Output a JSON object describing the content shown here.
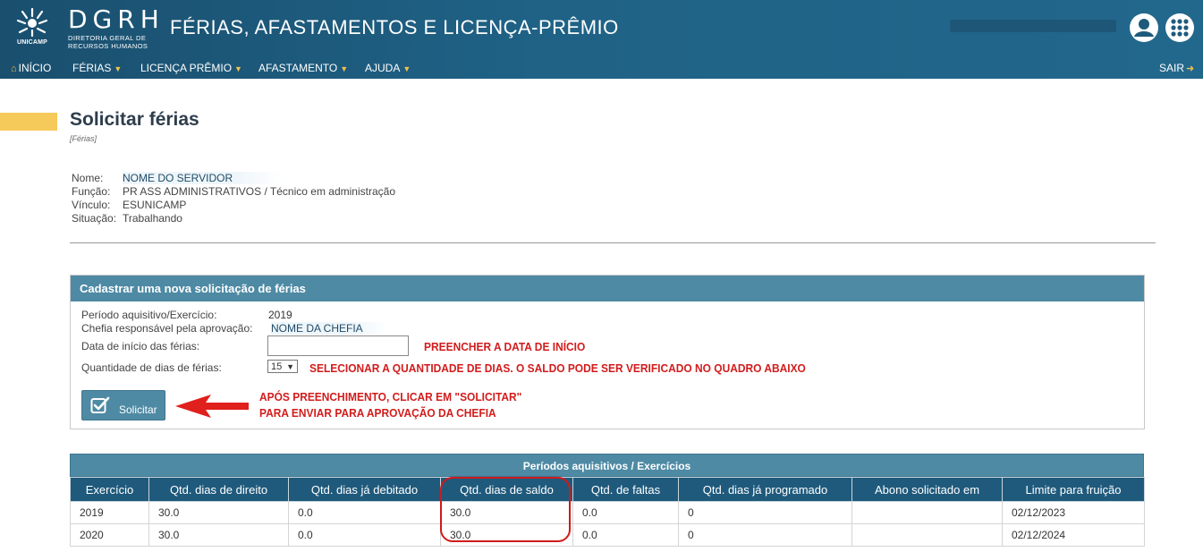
{
  "header": {
    "logo_text": "UNICAMP",
    "brand": "DGRH",
    "brand_sub_line1": "DIRETORIA GERAL DE",
    "brand_sub_line2": "RECURSOS HUMANOS",
    "app_title": "FÉRIAS, AFASTAMENTOS E LICENÇA-PRÊMIO"
  },
  "nav": {
    "inicio": "INÍCIO",
    "ferias": "FÉRIAS",
    "licenca": "LICENÇA PRÊMIO",
    "afastamento": "AFASTAMENTO",
    "ajuda": "AJUDA",
    "sair": "SAIR"
  },
  "page": {
    "title": "Solicitar férias",
    "breadcrumb": "[Férias]"
  },
  "servidor": {
    "nome_label": "Nome:",
    "nome": "NOME DO SERVIDOR",
    "funcao_label": "Função:",
    "funcao": "PR ASS ADMINISTRATIVOS / Técnico em administração",
    "vinculo_label": "Vínculo:",
    "vinculo": "ESUNICAMP",
    "situacao_label": "Situação:",
    "situacao": "Trabalhando"
  },
  "form": {
    "panel_title": "Cadastrar uma nova solicitação de férias",
    "periodo_label": "Período aquisitivo/Exercício:",
    "periodo_value": "2019",
    "chefia_label": "Chefia responsável pela aprovação:",
    "chefia_value": "NOME DA CHEFIA",
    "data_label": "Data de início das férias:",
    "data_value": "",
    "qtd_label": "Quantidade de dias de férias:",
    "qtd_value": "15",
    "submit_label": "Solicitar"
  },
  "annotations": {
    "data": "PREENCHER A DATA DE INÍCIO",
    "qtd": "SELECIONAR A QUANTIDADE DE DIAS. O SALDO PODE SER VERIFICADO NO QUADRO ABAIXO",
    "submit_line1": "APÓS PREENCHIMENTO, CLICAR EM \"SOLICITAR\"",
    "submit_line2": "PARA ENVIAR PARA APROVAÇÃO DA CHEFIA"
  },
  "table": {
    "title": "Períodos aquisitivos / Exercícios",
    "columns": [
      "Exercício",
      "Qtd. dias de direito",
      "Qtd. dias já debitado",
      "Qtd. dias de saldo",
      "Qtd. de faltas",
      "Qtd. dias já programado",
      "Abono solicitado em",
      "Limite para fruição"
    ],
    "rows": [
      [
        "2019",
        "30.0",
        "0.0",
        "30.0",
        "0.0",
        "0",
        "",
        "02/12/2023"
      ],
      [
        "2020",
        "30.0",
        "0.0",
        "30.0",
        "0.0",
        "0",
        "",
        "02/12/2024"
      ]
    ]
  },
  "colors": {
    "header_bg": "#1c5a7c",
    "panel_head": "#4e8aa4",
    "accent_yellow": "#f6ca5a",
    "annotation_red": "#d21c1c"
  }
}
